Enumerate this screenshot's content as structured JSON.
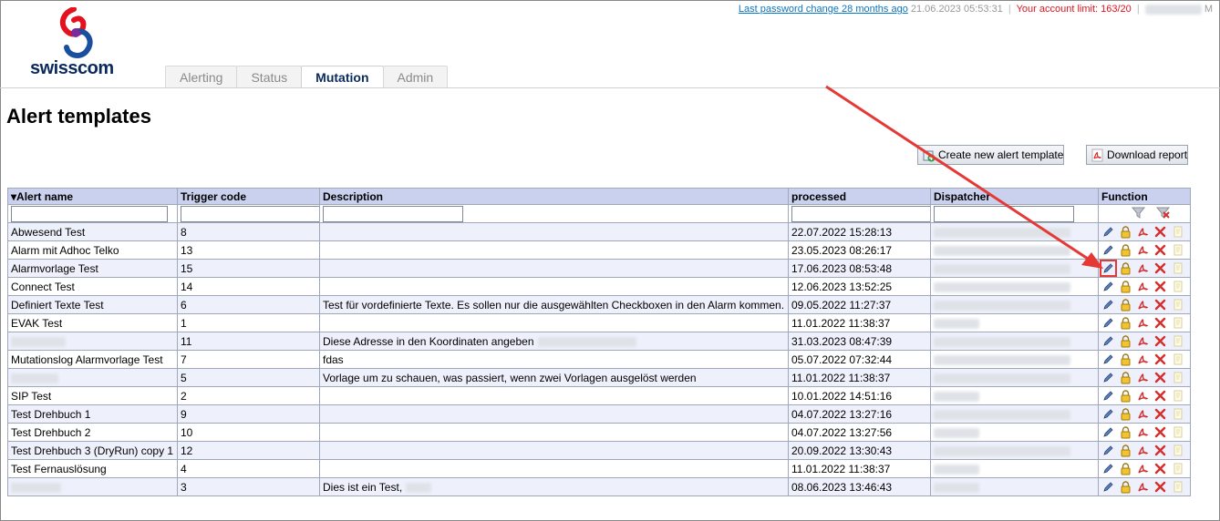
{
  "header": {
    "password_link": "Last password change 28 months ago",
    "datetime": "21.06.2023 05:53:31",
    "account_limit": "Your account limit: 163/20",
    "user_initial": "M"
  },
  "logo": {
    "text": "swisscom"
  },
  "tabs": [
    {
      "label": "Alerting"
    },
    {
      "label": "Status"
    },
    {
      "label": "Mutation",
      "active": true
    },
    {
      "label": "Admin"
    }
  ],
  "page_title": "Alert templates",
  "buttons": {
    "create": "Create new alert template",
    "download": "Download report"
  },
  "table": {
    "columns": [
      "▾Alert name",
      "Trigger code",
      "Description",
      "processed",
      "Dispatcher",
      "Function"
    ],
    "rows": [
      {
        "name": "Abwesend Test",
        "code": "8",
        "description": "",
        "processed": "22.07.2022 15:28:13"
      },
      {
        "name": "Alarm mit Adhoc Telko",
        "code": "13",
        "description": "",
        "processed": "23.05.2023 08:26:17"
      },
      {
        "name": "Alarmvorlage Test",
        "code": "15",
        "description": "",
        "processed": "17.06.2023 08:53:48"
      },
      {
        "name": "Connect Test",
        "code": "14",
        "description": "",
        "processed": "12.06.2023 13:52:25"
      },
      {
        "name": "Definiert Texte Test",
        "code": "6",
        "description": "Test für vordefinierte Texte. Es sollen nur die ausgewählten Checkboxen in den Alarm kommen.",
        "processed": "09.05.2022 11:27:37"
      },
      {
        "name": "EVAK Test",
        "code": "1",
        "description": "",
        "processed": "11.01.2022 11:38:37"
      },
      {
        "name": "",
        "code": "11",
        "description": "Diese Adresse in den Koordinaten angeben",
        "processed": "31.03.2023 08:47:39"
      },
      {
        "name": "Mutationslog Alarmvorlage Test",
        "code": "7",
        "description": "fdas",
        "processed": "05.07.2022 07:32:44"
      },
      {
        "name": "",
        "code": "5",
        "description": "Vorlage um zu schauen, was passiert, wenn zwei Vorlagen ausgelöst werden",
        "processed": "11.01.2022 11:38:37"
      },
      {
        "name": "SIP Test",
        "code": "2",
        "description": "",
        "processed": "10.01.2022 14:51:16"
      },
      {
        "name": "Test Drehbuch 1",
        "code": "9",
        "description": "",
        "processed": "04.07.2022 13:27:16"
      },
      {
        "name": "Test Drehbuch 2",
        "code": "10",
        "description": "",
        "processed": "04.07.2022 13:27:56"
      },
      {
        "name": "Test Drehbuch 3 (DryRun) copy 1",
        "code": "12",
        "description": "",
        "processed": "20.09.2022 13:30:43"
      },
      {
        "name": "Test Fernauslösung",
        "code": "4",
        "description": "",
        "processed": "11.01.2022 11:38:37"
      },
      {
        "name": "",
        "code": "3",
        "description": "Dies ist ein Test,",
        "processed": "08.06.2023 13:46:43"
      }
    ]
  },
  "colors": {
    "header_bg": "#c9d1ee",
    "row_alt": "#eef1fb",
    "link": "#0a76c2",
    "alert_red": "#e2121e",
    "annotation": "#e53935"
  },
  "icons": [
    "edit-icon",
    "lock-icon",
    "pdf-icon",
    "delete-icon",
    "copy-icon",
    "filter-icon",
    "clear-filter-icon"
  ]
}
